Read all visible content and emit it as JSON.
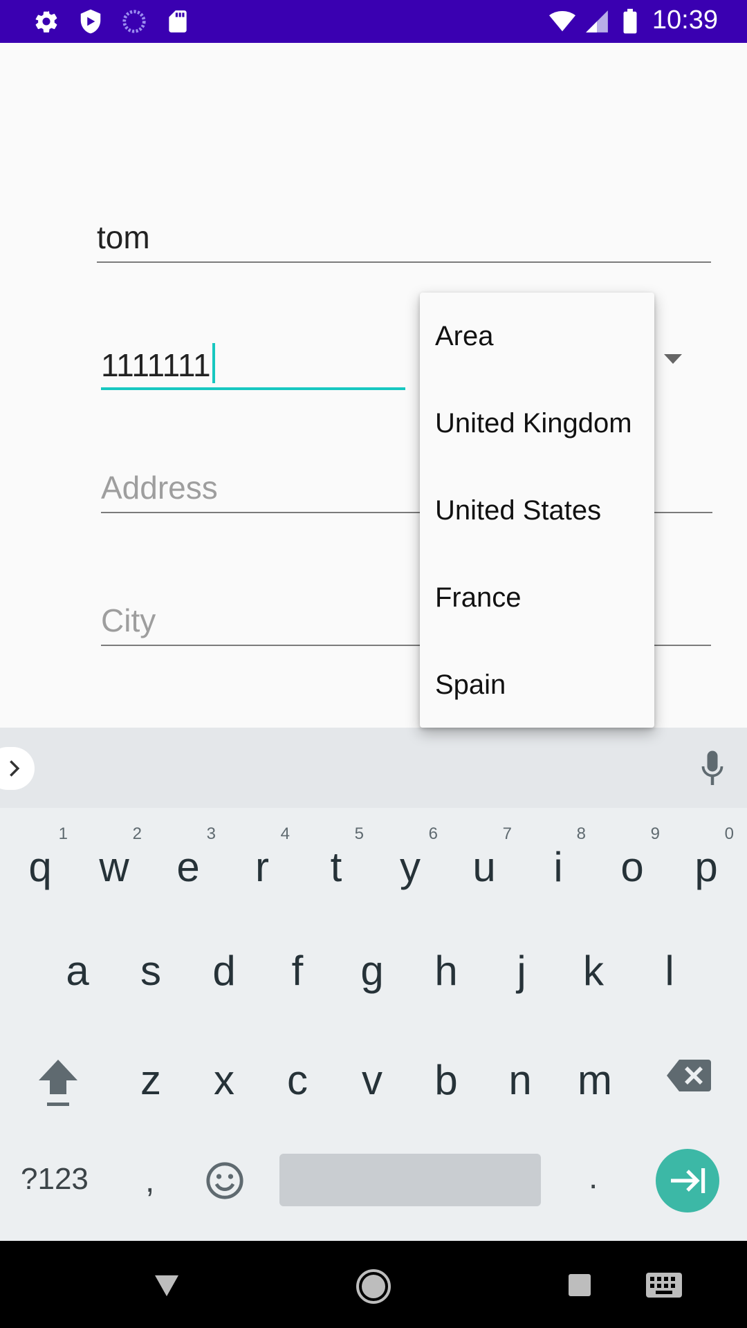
{
  "status_bar": {
    "time": "10:39",
    "left_icons": [
      "gear-icon",
      "shield-icon",
      "sync-icon",
      "sd-card-icon"
    ],
    "right_icons": [
      "wifi-icon",
      "signal-icon",
      "battery-icon"
    ]
  },
  "form": {
    "name_value": "tom",
    "phone_value": "1111111",
    "address_placeholder": "Address",
    "city_placeholder": "City"
  },
  "area_dropdown": {
    "options": [
      "Area",
      "United Kingdom",
      "United States",
      "France",
      "Spain"
    ]
  },
  "keyboard": {
    "row1": [
      {
        "key": "q",
        "hint": "1"
      },
      {
        "key": "w",
        "hint": "2"
      },
      {
        "key": "e",
        "hint": "3"
      },
      {
        "key": "r",
        "hint": "4"
      },
      {
        "key": "t",
        "hint": "5"
      },
      {
        "key": "y",
        "hint": "6"
      },
      {
        "key": "u",
        "hint": "7"
      },
      {
        "key": "i",
        "hint": "8"
      },
      {
        "key": "o",
        "hint": "9"
      },
      {
        "key": "p",
        "hint": "0"
      }
    ],
    "row2": [
      "a",
      "s",
      "d",
      "f",
      "g",
      "h",
      "j",
      "k",
      "l"
    ],
    "row3": [
      "z",
      "x",
      "c",
      "v",
      "b",
      "n",
      "m"
    ],
    "symbols_label": "?123",
    "comma": ",",
    "period": ".",
    "accent_color": "#3cb8a6"
  },
  "colors": {
    "status_bar": "#3a00b1",
    "focus_underline": "#17c7c0"
  }
}
